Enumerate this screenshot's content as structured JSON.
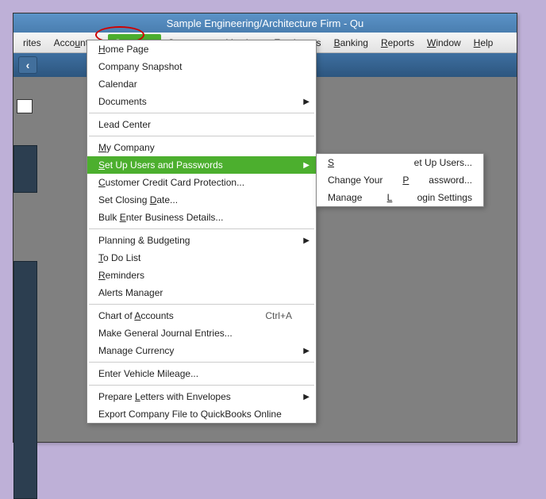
{
  "title": "Sample Engineering/Architecture Firm  - Qu",
  "menubar": {
    "items": [
      {
        "raw": "rites",
        "underline": null
      },
      {
        "raw": "Accountant",
        "underline": "u"
      },
      {
        "raw": "Company",
        "underline": "C"
      },
      {
        "raw": "Customers",
        "underline": null
      },
      {
        "raw": "Vendors",
        "underline": "V"
      },
      {
        "raw": "Employees",
        "underline": "E"
      },
      {
        "raw": "Banking",
        "underline": "B"
      },
      {
        "raw": "Reports",
        "underline": "R"
      },
      {
        "raw": "Window",
        "underline": "W"
      },
      {
        "raw": "Help",
        "underline": "H"
      }
    ],
    "active_index": 2
  },
  "company_menu": {
    "groups": [
      [
        {
          "label": "Home Page",
          "u": "H"
        },
        {
          "label": "Company Snapshot"
        },
        {
          "label": "Calendar"
        },
        {
          "label": "Documents",
          "arrow": true
        }
      ],
      [
        {
          "label": "Lead Center"
        }
      ],
      [
        {
          "label": "My Company",
          "u": "M"
        },
        {
          "label": "Set Up Users and Passwords",
          "u": "S",
          "arrow": true,
          "highlight": true
        },
        {
          "label": "Customer Credit Card Protection...",
          "u": "C"
        },
        {
          "label": "Set Closing Date...",
          "u": "D"
        },
        {
          "label": "Bulk Enter Business Details...",
          "u": "E"
        }
      ],
      [
        {
          "label": "Planning & Budgeting",
          "arrow": true
        },
        {
          "label": "To Do List",
          "u": "T"
        },
        {
          "label": "Reminders",
          "u": "R"
        },
        {
          "label": "Alerts Manager"
        }
      ],
      [
        {
          "label": "Chart of Accounts",
          "u": "A",
          "shortcut": "Ctrl+A"
        },
        {
          "label": "Make General Journal Entries..."
        },
        {
          "label": "Manage Currency",
          "arrow": true
        }
      ],
      [
        {
          "label": "Enter Vehicle Mileage..."
        }
      ],
      [
        {
          "label": "Prepare Letters with Envelopes",
          "u": "L",
          "arrow": true
        },
        {
          "label": "Export Company File to QuickBooks Online"
        }
      ]
    ]
  },
  "submenu": {
    "items": [
      {
        "label": "Set Up Users...",
        "u": "S",
        "highlight": true
      },
      {
        "label": "Change Your Password...",
        "u": "P"
      },
      {
        "label": "Manage Login Settings",
        "u": "L"
      }
    ]
  }
}
